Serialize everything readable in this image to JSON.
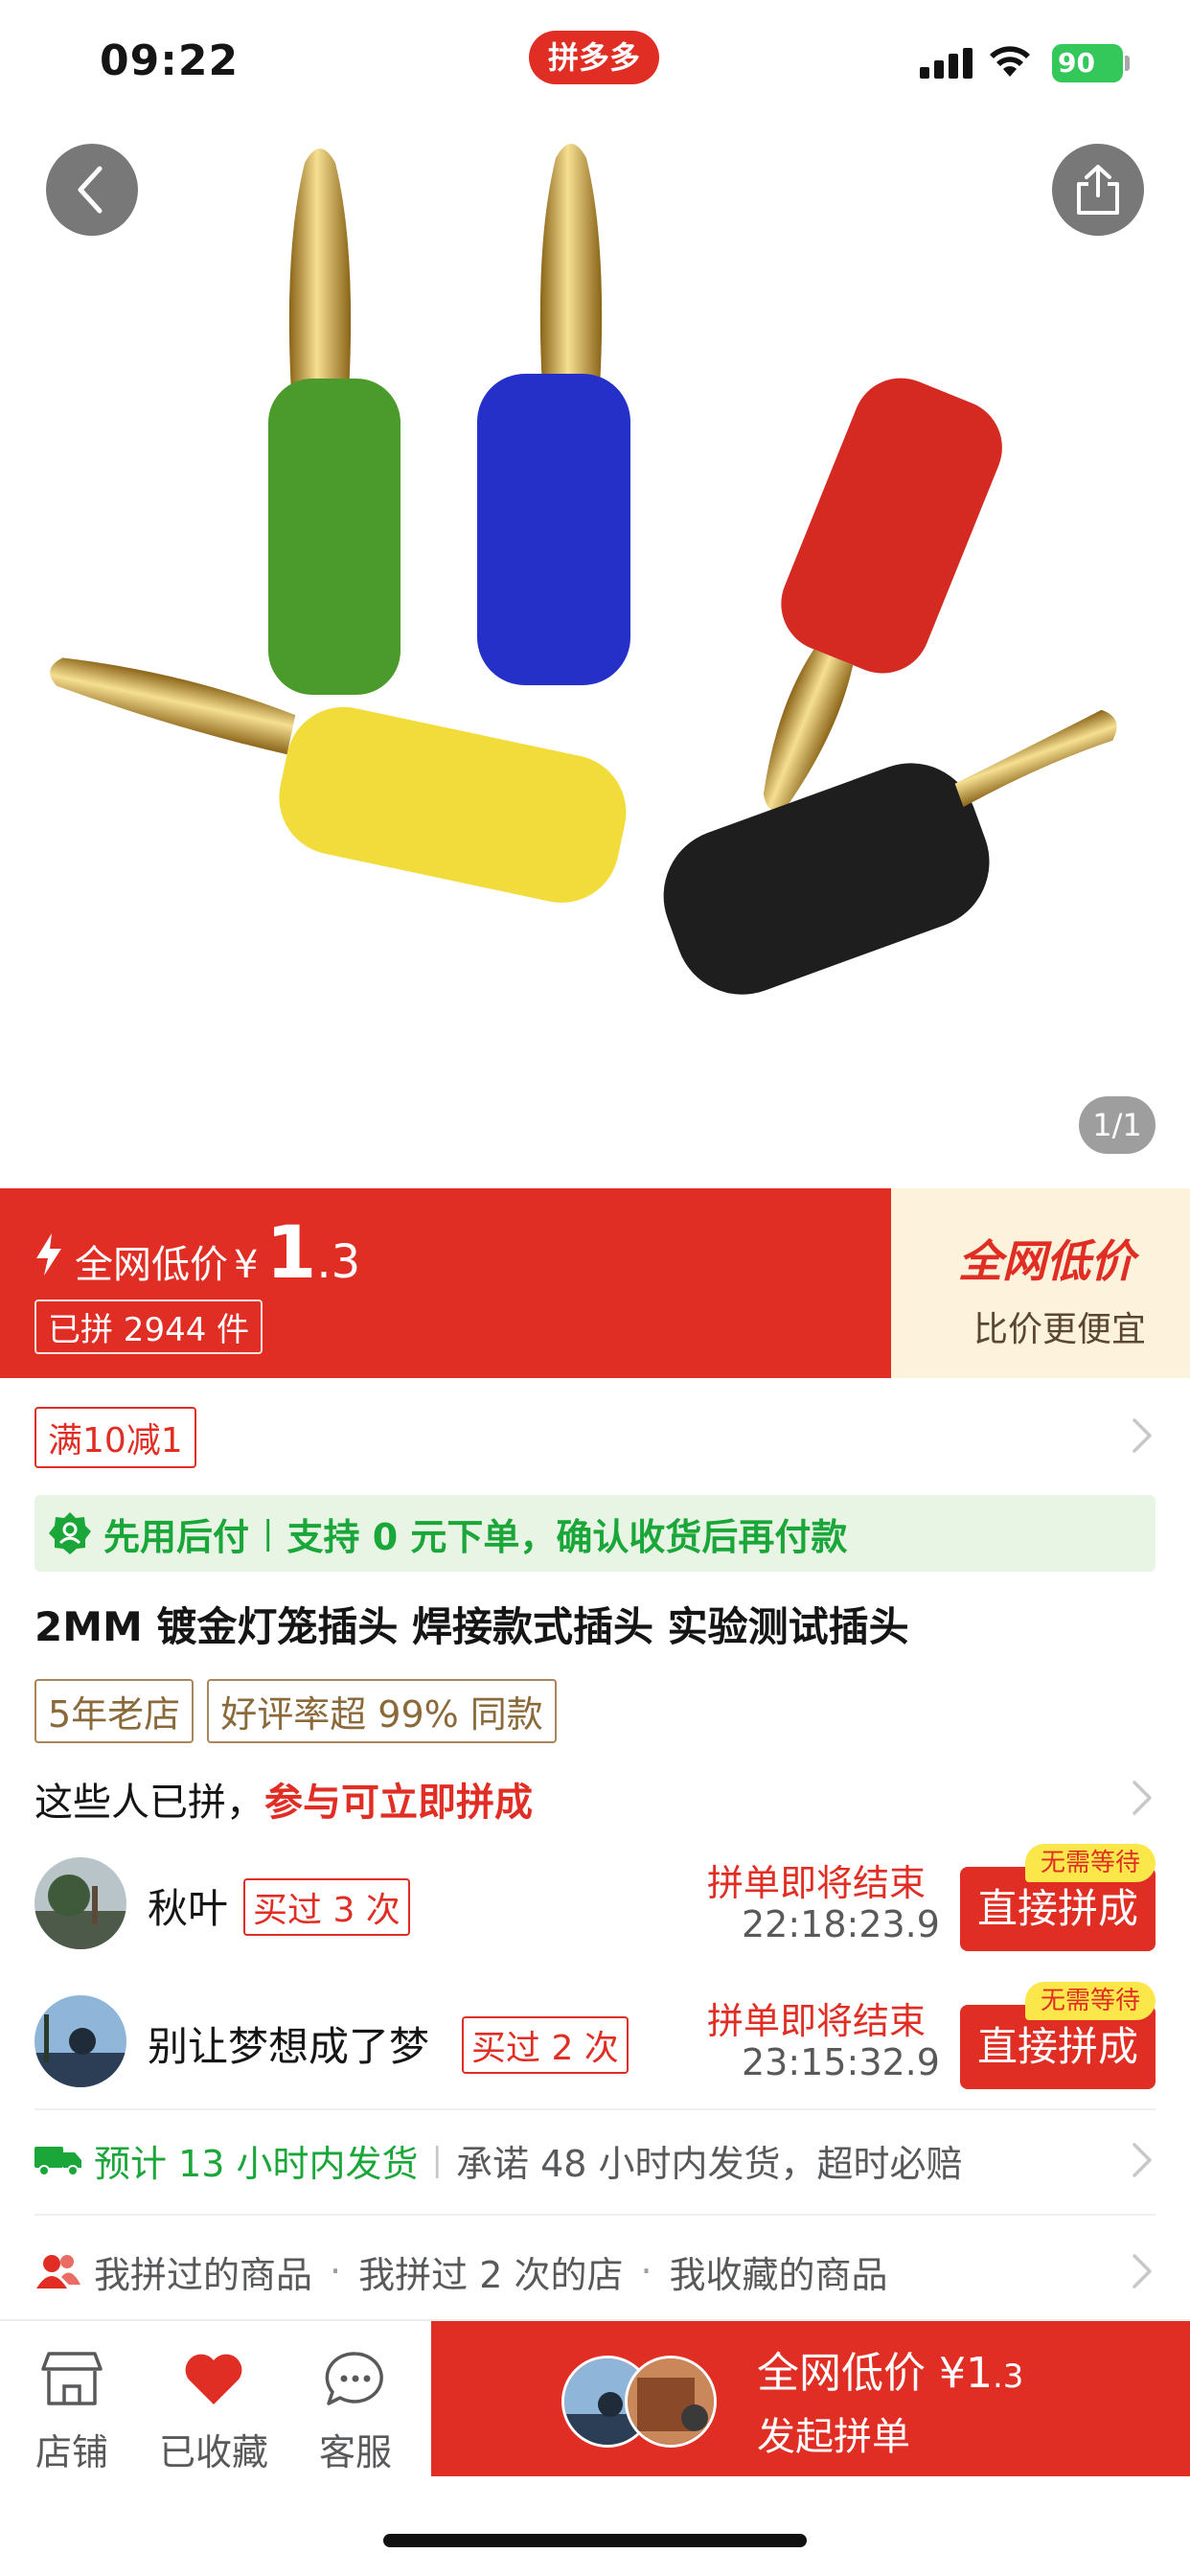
{
  "status_bar": {
    "time": "09:22",
    "app_badge": "拼多多",
    "battery": "90"
  },
  "product_image": {
    "counter": "1/1",
    "plug_colors": [
      "#4a9a2c",
      "#2430c8",
      "#d42a22",
      "#f2dc3c",
      "#1e1e1e"
    ]
  },
  "price_banner": {
    "label": "全网低价",
    "currency": "¥",
    "price_int": "1",
    "price_dec": ".3",
    "sold_count": "已拼 2944 件",
    "promo_title": "全网低价",
    "promo_sub": "比价更便宜"
  },
  "coupon": {
    "label": "满10减1"
  },
  "pay_later": {
    "title": "先用后付",
    "desc": "支持 0 元下单，确认收货后再付款"
  },
  "product": {
    "title": "2MM 镀金灯笼插头 焊接款式插头 实验测试插头",
    "tags": [
      "5年老店",
      "好评率超 99% 同款"
    ]
  },
  "group_buy": {
    "header_plain": "这些人已拼，",
    "header_highlight": "参与可立即拼成",
    "groups": [
      {
        "name": "秋叶",
        "bought": "买过 3 次",
        "ending_label": "拼单即将结束",
        "countdown": "22:18:23.9",
        "button": "直接拼成",
        "badge": "无需等待"
      },
      {
        "name": "别让梦想成了梦",
        "bought": "买过 2 次",
        "ending_label": "拼单即将结束",
        "countdown": "23:15:32.9",
        "button": "直接拼成",
        "badge": "无需等待"
      }
    ]
  },
  "shipping": {
    "eta": "预计 13 小时内发货",
    "promise": "承诺 48 小时内发货，超时必赔"
  },
  "history": {
    "items": [
      "我拼过的商品",
      "我拼过 2 次的店",
      "我收藏的商品"
    ]
  },
  "bottom_bar": {
    "tabs": [
      {
        "label": "店铺",
        "icon": "store-icon"
      },
      {
        "label": "已收藏",
        "icon": "heart-icon"
      },
      {
        "label": "客服",
        "icon": "chat-icon"
      }
    ],
    "cta_price_label": "全网低价 ¥",
    "cta_price_int": "1",
    "cta_price_dec": ".3",
    "cta_sub": "发起拼单"
  },
  "colors": {
    "brand_red": "#e02e24",
    "green": "#1aa639",
    "gold": "#a8865a",
    "badge_yellow": "#fbe74a"
  }
}
